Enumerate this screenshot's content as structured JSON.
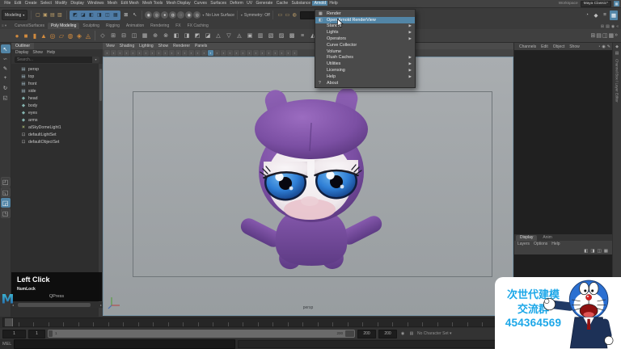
{
  "menubar": {
    "items": [
      "File",
      "Edit",
      "Create",
      "Select",
      "Modify",
      "Display",
      "Windows",
      "Mesh",
      "Edit Mesh",
      "Mesh Tools",
      "Mesh Display",
      "Curves",
      "Surfaces",
      "Deform",
      "UV",
      "Generate",
      "Cache",
      "Substance",
      "Arnold",
      "Help"
    ],
    "active_item": "Arnold",
    "workspace_label": "Workspace",
    "workspace_value": "Maya Classic*"
  },
  "statusline": {
    "mode_selector": "Modeling",
    "live_surface_label": "No Live Surface",
    "symmetry_label": "Symmetry: Off"
  },
  "shelf": {
    "tabs": [
      "Curves/Surfaces",
      "Poly Modeling",
      "Sculpting",
      "Rigging",
      "Animation",
      "Rendering",
      "FX",
      "FX Caching"
    ],
    "active_tab": "Poly Modeling",
    "primitive_icons": [
      "sphere",
      "cube",
      "cylinder",
      "cone",
      "torus",
      "plane",
      "disc",
      "platonic-solid",
      "super-shape"
    ],
    "tool_icons": [
      "extrude",
      "bevel",
      "bridge",
      "multi-cut",
      "target-weld",
      "quad-draw",
      "smooth",
      "mirror",
      "combine",
      "separate",
      "boolean-union",
      "boolean-difference",
      "wedge",
      "poke",
      "duplicate-face",
      "circularize",
      "crease-tool",
      "spin-edge",
      "append-polygon",
      "sculpt-tool",
      "relax-tool",
      "grab-tool"
    ]
  },
  "toolbox": {
    "tools": [
      "select",
      "lasso",
      "paint-select",
      "move",
      "rotate",
      "scale"
    ],
    "active_tool": "select",
    "layouts": [
      "single-pane",
      "four-pane",
      "persp-outliner",
      "hypershade-persp"
    ],
    "active_layout": "persp-outliner"
  },
  "outliner": {
    "tab_title": "Outliner",
    "menus": [
      "Display",
      "Show",
      "Help"
    ],
    "search_placeholder": "Search...",
    "items": [
      {
        "icon": "camera",
        "label": "persp"
      },
      {
        "icon": "camera",
        "label": "top"
      },
      {
        "icon": "camera",
        "label": "front"
      },
      {
        "icon": "camera",
        "label": "side"
      },
      {
        "icon": "mesh",
        "label": "head"
      },
      {
        "icon": "mesh",
        "label": "body"
      },
      {
        "icon": "mesh",
        "label": "eyes"
      },
      {
        "icon": "mesh",
        "label": "arms"
      },
      {
        "icon": "light",
        "label": "aiSkyDomeLight1"
      },
      {
        "icon": "set",
        "label": "defaultLightSet"
      },
      {
        "icon": "set",
        "label": "defaultObjectSet"
      }
    ]
  },
  "viewport": {
    "menus": [
      "View",
      "Shading",
      "Lighting",
      "Show",
      "Renderer",
      "Panels"
    ],
    "camera_label": "persp",
    "toolbar_icons": [
      "select-camera",
      "lock-camera",
      "camera-attributes",
      "bookmarks",
      "image-plane",
      "2d-pan-zoom",
      "grease-pencil",
      "grid",
      "film-gate",
      "resolution-gate",
      "gate-mask",
      "field-chart",
      "safe-action",
      "safe-title",
      "frame-all",
      "frame-selection",
      "isolate-select",
      "wireframe",
      "shaded",
      "textured",
      "use-all-lights",
      "shadows",
      "ambient-occlusion",
      "motion-blur",
      "multisample-aa",
      "depth-of-field",
      "fog",
      "x-ray",
      "exposure",
      "gamma"
    ],
    "active_toolbar_icon": "isolate-select"
  },
  "arnold_menu": {
    "items": [
      {
        "label": "Render",
        "icon": "render-icon",
        "submenu": false,
        "highlighted": false
      },
      {
        "label": "Open Arnold RenderView",
        "icon": "renderview-icon",
        "submenu": false,
        "highlighted": true
      },
      {
        "label": "Standin",
        "submenu": true,
        "highlighted": false
      },
      {
        "label": "Lights",
        "submenu": true,
        "highlighted": false
      },
      {
        "label": "Operators",
        "submenu": true,
        "highlighted": false
      },
      {
        "label": "Curve Collector",
        "submenu": false,
        "highlighted": false
      },
      {
        "label": "Volume",
        "submenu": false,
        "highlighted": false
      },
      {
        "label": "Flush Caches",
        "submenu": true,
        "highlighted": false
      },
      {
        "label": "Utilities",
        "submenu": true,
        "highlighted": false
      },
      {
        "label": "Licensing",
        "submenu": true,
        "highlighted": false
      },
      {
        "label": "Help",
        "submenu": true,
        "highlighted": false
      },
      {
        "label": "About",
        "icon": "about-icon",
        "submenu": false,
        "highlighted": false
      }
    ]
  },
  "channel_box": {
    "menus": [
      "Channels",
      "Edit",
      "Object",
      "Show"
    ]
  },
  "layer_editor": {
    "tabs": [
      "Display",
      "Anim"
    ],
    "active_tab": "Display",
    "menus": [
      "Layers",
      "Options",
      "Help"
    ]
  },
  "right_strip": {
    "label": "Channel Box / Layer Editor"
  },
  "key_overlay": {
    "title": "Left Click",
    "modifier": "NumLock",
    "keys": "QPress"
  },
  "timeline": {
    "animation_start": "1",
    "playback_start": "1",
    "playback_end": "200",
    "animation_end": "200",
    "range_bar_start": "1",
    "range_bar_end": "200",
    "character_set": "No Character Set"
  },
  "command_line": {
    "label": "MEL"
  },
  "watermark": {
    "line1": "次世代建模",
    "line2": "交流群",
    "line3": "454364569",
    "text_color": "#1ca7e8"
  },
  "colors": {
    "accent_blue": "#5285a6",
    "shelf_orange": "#d08a3e",
    "character_purple": "#7a4fa3"
  }
}
